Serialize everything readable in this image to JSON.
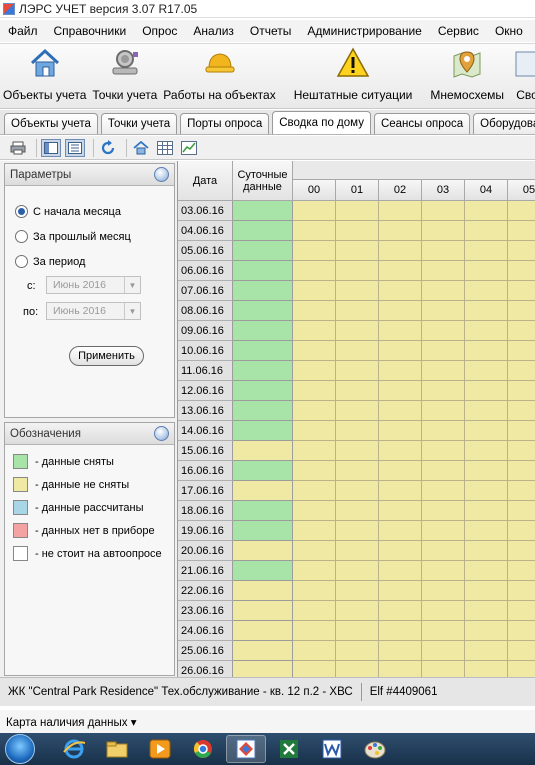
{
  "window": {
    "title": "ЛЭРС УЧЕТ версия 3.07 R17.05"
  },
  "menu": [
    "Файл",
    "Справочники",
    "Опрос",
    "Анализ",
    "Отчеты",
    "Администрирование",
    "Сервис",
    "Окно"
  ],
  "toolbar": {
    "buttons": [
      {
        "label": "Объекты учета",
        "icon": "house-icon"
      },
      {
        "label": "Точки учета",
        "icon": "meter-icon"
      },
      {
        "label": "Работы на объектах",
        "icon": "hardhat-icon"
      },
      {
        "label": "Нештатные ситуации",
        "icon": "warning-icon"
      },
      {
        "label": "Мнемосхемы",
        "icon": "map-pin-icon"
      },
      {
        "label": "Сво",
        "icon": "summary-icon"
      }
    ]
  },
  "tabs": [
    "Объекты учета",
    "Точки учета",
    "Порты опроса",
    "Сводка по дому",
    "Сеансы опроса",
    "Оборудова"
  ],
  "params": {
    "title": "Параметры",
    "options": [
      "С начала месяца",
      "За прошлый месяц",
      "За период"
    ],
    "selected_index": 0,
    "from_label": "с:",
    "to_label": "по:",
    "from_value": "Июнь 2016",
    "to_value": "Июнь 2016",
    "apply": "Применить"
  },
  "legend": {
    "title": "Обозначения",
    "items": [
      {
        "label": "- данные сняты",
        "color": "#a8e3a8"
      },
      {
        "label": "- данные не сняты",
        "color": "#f0e9a3"
      },
      {
        "label": "- данные рассчитаны",
        "color": "#a9d6e6"
      },
      {
        "label": "- данных нет в приборе",
        "color": "#f4a3a3"
      },
      {
        "label": "- не стоит на автоопросе",
        "color": "#ffffff"
      }
    ]
  },
  "grid": {
    "date_header": "Дата",
    "daily_header": "Суточные данные",
    "hours": [
      "00",
      "01",
      "02",
      "03",
      "04",
      "05"
    ],
    "colors": {
      "taken": "#a8e3a8",
      "not_taken": "#f0e9a3"
    },
    "rows": [
      {
        "date": "03.06.16",
        "daily": "taken"
      },
      {
        "date": "04.06.16",
        "daily": "taken"
      },
      {
        "date": "05.06.16",
        "daily": "taken"
      },
      {
        "date": "06.06.16",
        "daily": "taken"
      },
      {
        "date": "07.06.16",
        "daily": "taken"
      },
      {
        "date": "08.06.16",
        "daily": "taken"
      },
      {
        "date": "09.06.16",
        "daily": "taken"
      },
      {
        "date": "10.06.16",
        "daily": "taken"
      },
      {
        "date": "11.06.16",
        "daily": "taken"
      },
      {
        "date": "12.06.16",
        "daily": "taken"
      },
      {
        "date": "13.06.16",
        "daily": "taken"
      },
      {
        "date": "14.06.16",
        "daily": "taken"
      },
      {
        "date": "15.06.16",
        "daily": "not_taken"
      },
      {
        "date": "16.06.16",
        "daily": "taken"
      },
      {
        "date": "17.06.16",
        "daily": "not_taken"
      },
      {
        "date": "18.06.16",
        "daily": "taken"
      },
      {
        "date": "19.06.16",
        "daily": "taken"
      },
      {
        "date": "20.06.16",
        "daily": "not_taken"
      },
      {
        "date": "21.06.16",
        "daily": "taken"
      },
      {
        "date": "22.06.16",
        "daily": "not_taken"
      },
      {
        "date": "23.06.16",
        "daily": "not_taken"
      },
      {
        "date": "24.06.16",
        "daily": "not_taken"
      },
      {
        "date": "25.06.16",
        "daily": "not_taken"
      },
      {
        "date": "26.06.16",
        "daily": "not_taken"
      }
    ]
  },
  "status": {
    "object": "ЖК \"Central Park Residence\"  Тех.обслуживание - кв. 12 п.2 - ХВС",
    "device": "Elf #4409061"
  },
  "view": {
    "label": "Карта наличия данных ▾"
  },
  "taskbar": [
    "ie-icon",
    "explorer-icon",
    "media-player-icon",
    "chrome-icon",
    "lers-icon",
    "excel-icon",
    "word-icon",
    "paint-icon"
  ]
}
